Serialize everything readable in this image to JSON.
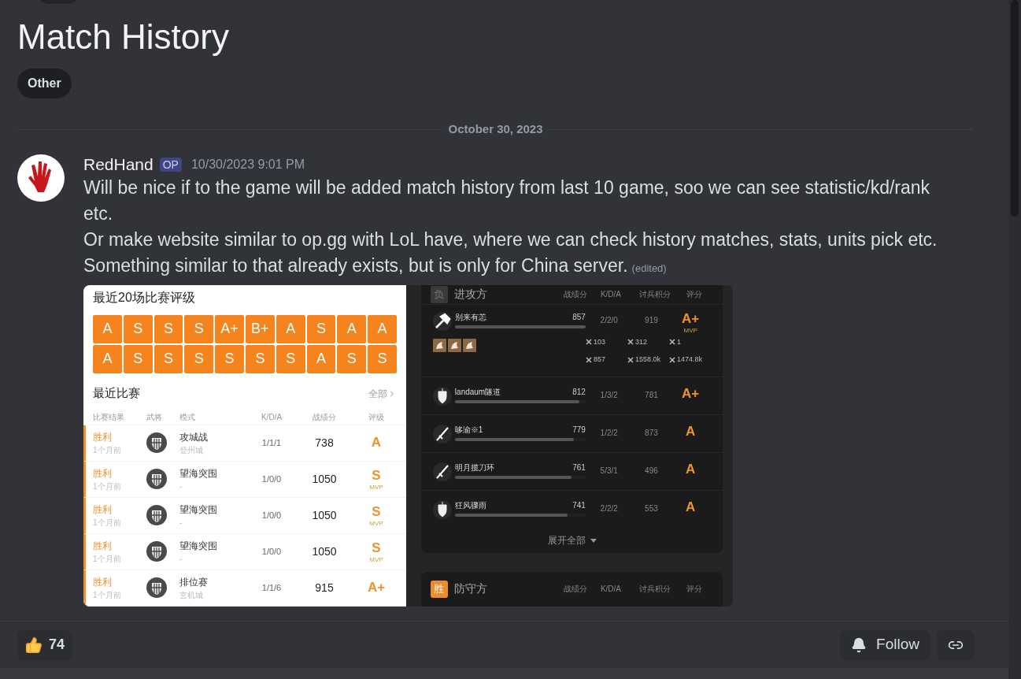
{
  "post": {
    "title": "Match History",
    "tag": "Other"
  },
  "date_divider": "October 30, 2023",
  "message": {
    "author": "RedHand",
    "badge": "OP",
    "timestamp": "10/30/2023 9:01 PM",
    "paragraphs": [
      "Will be nice if to the game will be added match history from last 10 game, soo we can see statistic/kd/rank etc.",
      "Or make website similar to op.gg with LoL have, where we can check history matches, stats, units pick etc.",
      "Something similar to that already exists, but is only for China server."
    ],
    "edited": "(edited)"
  },
  "image_recent": {
    "grades_title": "最近20场比赛评级",
    "grades": [
      [
        "A",
        "S",
        "S",
        "S",
        "A+",
        "B+",
        "A",
        "S",
        "A",
        "A"
      ],
      [
        "A",
        "S",
        "S",
        "S",
        "S",
        "S",
        "S",
        "A",
        "S",
        "S"
      ]
    ],
    "section_title": "最近比赛",
    "all_link": "全部",
    "columns": [
      "比赛结果",
      "武将",
      "模式",
      "K/D/A",
      "战绩分",
      "评级"
    ],
    "rows": [
      {
        "result": "胜利",
        "time": "1个月前",
        "mode": "攻城战",
        "map": "登州城",
        "kda": "1/1/1",
        "score": "738",
        "grade": "A"
      },
      {
        "result": "胜利",
        "time": "1个月前",
        "mode": "望海突围",
        "map": "-",
        "kda": "1/0/0",
        "score": "1050",
        "grade": "S",
        "mvp_label": "MVP"
      },
      {
        "result": "胜利",
        "time": "1个月前",
        "mode": "望海突围",
        "map": "-",
        "kda": "1/0/0",
        "score": "1050",
        "grade": "S",
        "mvp_label": "MVP"
      },
      {
        "result": "胜利",
        "time": "1个月前",
        "mode": "望海突围",
        "map": "-",
        "kda": "1/0/0",
        "score": "1050",
        "grade": "S",
        "mvp_label": "MVP"
      },
      {
        "result": "胜利",
        "time": "1个月前",
        "mode": "排位赛",
        "map": "玄机城",
        "kda": "1/1/6",
        "score": "915",
        "grade": "A+"
      }
    ]
  },
  "image_match": {
    "attack": {
      "outcome": "负",
      "won": false,
      "side": "进攻方",
      "columns": [
        "战绩分",
        "K/D/A",
        "讨兵积分",
        "评分"
      ]
    },
    "players": [
      {
        "name": "别来有恙",
        "score": "857",
        "level": 1.0,
        "kda": "2/2/0",
        "points": "919",
        "grade": "A+",
        "mvp_label": "MVP",
        "stats": [
          "103",
          "312",
          "1",
          "857",
          "1558.0k",
          "1474.8k"
        ]
      },
      {
        "name": "landaum隧道",
        "score": "812",
        "level": 0.95,
        "kda": "1/3/2",
        "points": "781",
        "grade": "A+"
      },
      {
        "name": "哆渝※1",
        "score": "779",
        "level": 0.91,
        "kda": "1/2/2",
        "points": "873",
        "grade": "A"
      },
      {
        "name": "明月揽刀环",
        "score": "761",
        "level": 0.89,
        "kda": "5/3/1",
        "points": "496",
        "grade": "A"
      },
      {
        "name": "狂风骤雨",
        "score": "741",
        "level": 0.86,
        "kda": "2/2/2",
        "points": "553",
        "grade": "A"
      }
    ],
    "expand_label": "展开全部",
    "defense": {
      "outcome": "胜",
      "won": true,
      "side": "防守方",
      "columns": [
        "战绩分",
        "K/D/A",
        "讨兵积分",
        "评分"
      ]
    }
  },
  "footer": {
    "reaction_count": "74",
    "follow_label": "Follow"
  }
}
